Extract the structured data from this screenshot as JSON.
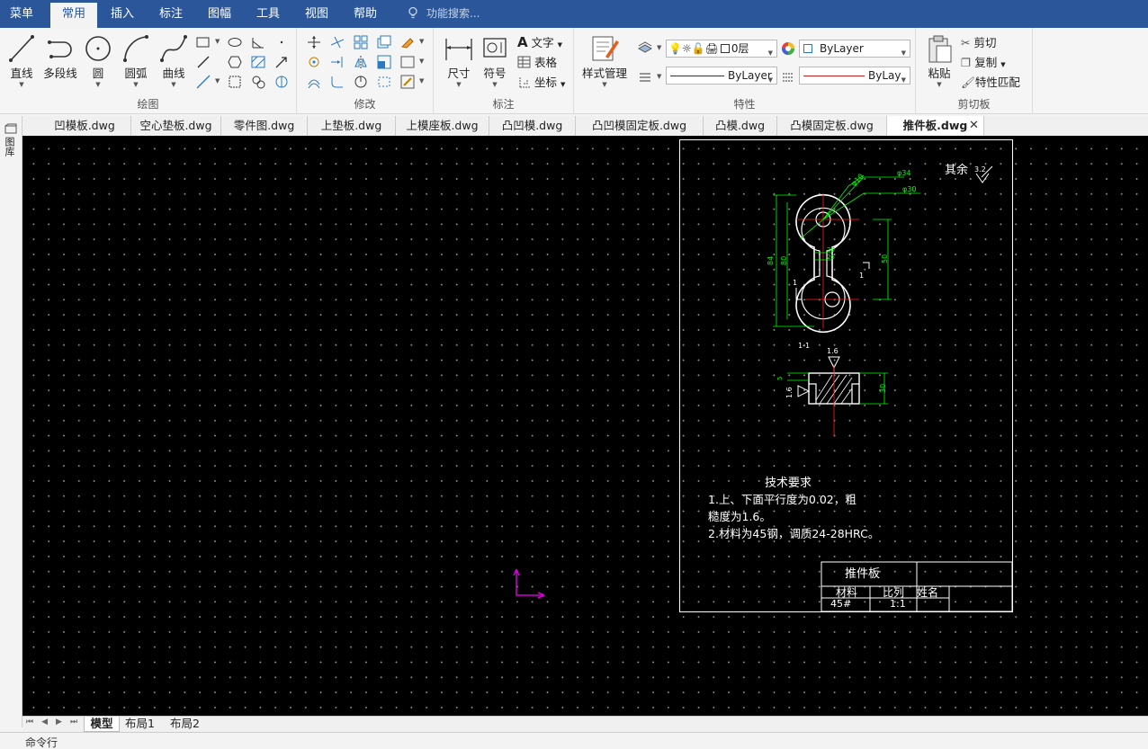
{
  "menu": {
    "items": [
      "菜单",
      "常用",
      "插入",
      "标注",
      "图幅",
      "工具",
      "视图",
      "帮助"
    ],
    "search_placeholder": "功能搜索..."
  },
  "ribbon": {
    "draw": {
      "title": "绘图",
      "line": "直线",
      "polyline": "多段线",
      "circle": "圆",
      "arc": "圆弧",
      "curve": "曲线"
    },
    "modify": {
      "title": "修改"
    },
    "annotation": {
      "title": "标注",
      "dimension": "尺寸",
      "symbol": "符号",
      "text": "文字",
      "table": "表格",
      "coordinate": "坐标"
    },
    "properties": {
      "title": "特性",
      "style_manager": "样式管理",
      "layer": "0层",
      "color": "ByLayer",
      "linetype": "ByLayer",
      "lineweight": "ByLay"
    },
    "clipboard": {
      "title": "剪切板",
      "paste": "粘贴",
      "cut": "剪切",
      "copy": "复制",
      "match": "特性匹配"
    }
  },
  "left_panel_label": "图库",
  "doc_tabs": [
    "凹模板.dwg",
    "空心垫板.dwg",
    "零件图.dwg",
    "上垫板.dwg",
    "上模座板.dwg",
    "凸凹模.dwg",
    "凸凹模固定板.dwg",
    "凸模.dwg",
    "凸模固定板.dwg",
    "推件板.dwg"
  ],
  "active_doc": "推件板.dwg",
  "drawing": {
    "roughness_note": "其余",
    "roughness_value": "3.2",
    "dims": {
      "phi10": "φ10",
      "phi34": "φ34",
      "phi30": "φ30",
      "d84": "84",
      "d80": "80",
      "d50": "50",
      "d20": "20",
      "d25": "25",
      "section": "1-1",
      "sec_mark": "1",
      "r16": "1.6",
      "t5": "5",
      "t30": "30"
    },
    "tech_title": "技术要求",
    "tech_line1": "1.上、下面平行度为0.02，粗",
    "tech_line2": "糙度为1.6。",
    "tech_line3": "2.材料为45钢，调质24-28HRC。",
    "tb_name": "推件板",
    "tb_material_label": "材料",
    "tb_scale_label": "比列",
    "tb_person_label": "姓名",
    "tb_material": "45#",
    "tb_scale": "1:1"
  },
  "layout_tabs": [
    "模型",
    "布局1",
    "布局2"
  ],
  "command_prompt": "命令行",
  "colors": {
    "accent": "#2b579a",
    "dim_green": "#00ff00",
    "axis_red": "#ff2020",
    "ucs_magenta": "#d400d4"
  }
}
